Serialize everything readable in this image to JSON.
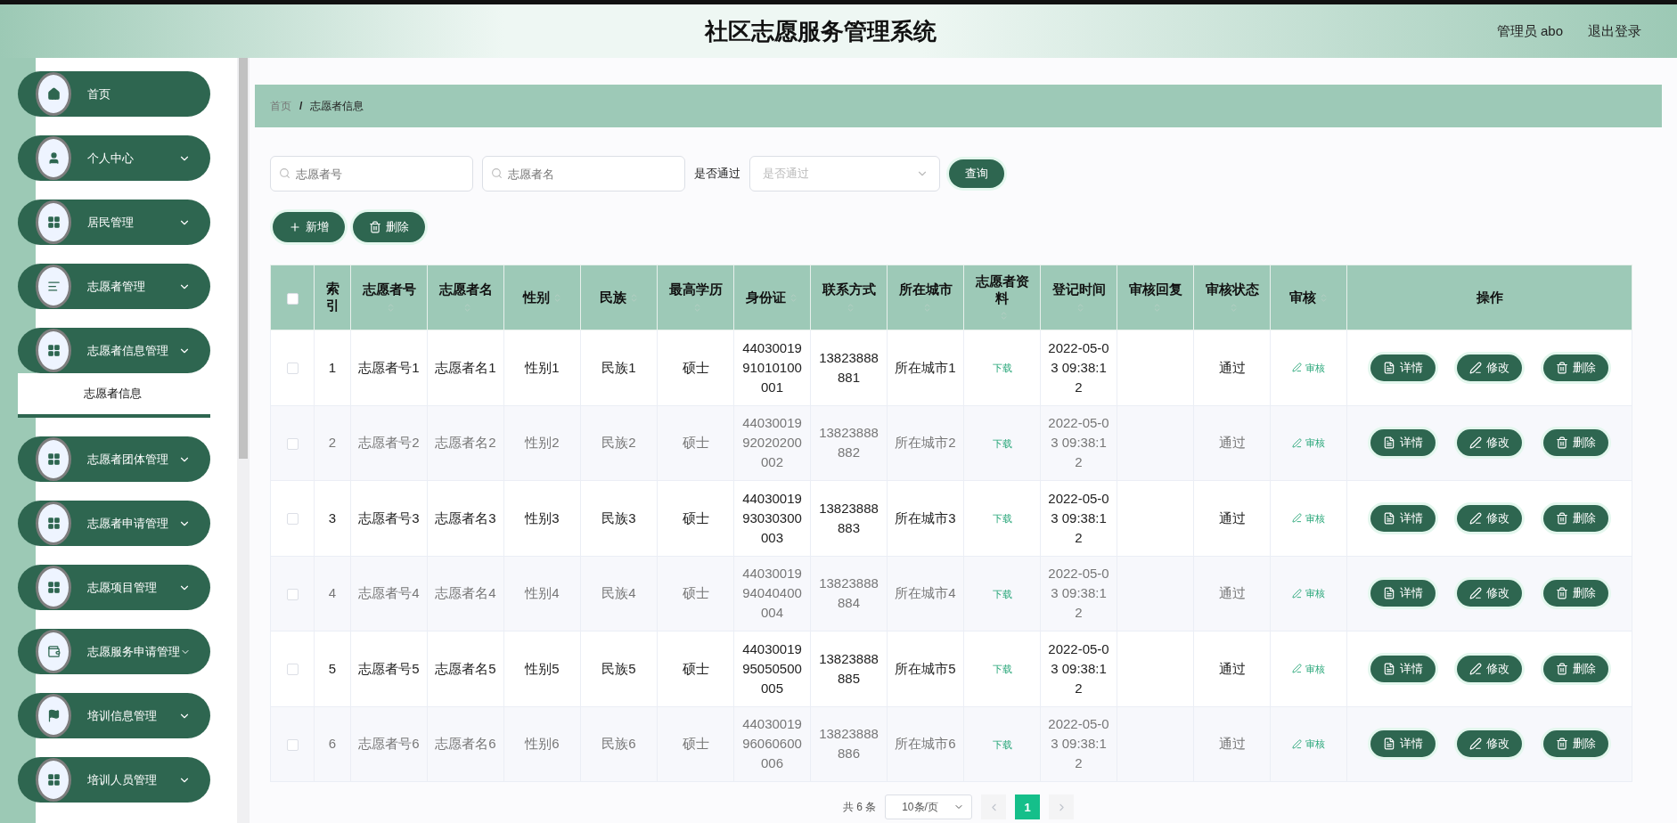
{
  "header": {
    "title": "社区志愿服务管理系统",
    "user": "管理员 abo",
    "logout": "退出登录"
  },
  "sidebar": {
    "items": [
      {
        "label": "首页",
        "kind": "home"
      },
      {
        "label": "个人中心",
        "kind": "user"
      },
      {
        "label": "居民管理",
        "kind": "grid"
      },
      {
        "label": "志愿者管理",
        "kind": "list"
      },
      {
        "label": "志愿者信息管理",
        "kind": "grid",
        "expanded": true,
        "children": [
          {
            "label": "志愿者信息",
            "selected": true
          }
        ]
      },
      {
        "label": "志愿者团体管理",
        "kind": "grid"
      },
      {
        "label": "志愿者申请管理",
        "kind": "grid"
      },
      {
        "label": "志愿项目管理",
        "kind": "grid"
      },
      {
        "label": "志愿服务申请管理",
        "kind": "wallet"
      },
      {
        "label": "培训信息管理",
        "kind": "flag"
      },
      {
        "label": "培训人员管理",
        "kind": "grid"
      }
    ]
  },
  "breadcrumb": {
    "items": [
      "首页",
      "志愿者信息"
    ],
    "separator": "/"
  },
  "filters": {
    "fields": [
      {
        "placeholder": "志愿者号"
      },
      {
        "placeholder": "志愿者名"
      }
    ],
    "select_label": "是否通过",
    "select": {
      "placeholder": "是否通过"
    },
    "search_button": "查询"
  },
  "toolbar": [
    {
      "label": "新增",
      "kind": "plus"
    },
    {
      "label": "删除",
      "kind": "trash"
    }
  ],
  "table": {
    "select_all_checked": false,
    "columns": [
      {
        "label": "索引",
        "kind": "index",
        "sortable": false
      },
      {
        "label": "志愿者号",
        "kind": "text",
        "sortable": true
      },
      {
        "label": "志愿者名",
        "kind": "text",
        "sortable": true
      },
      {
        "label": "性别",
        "kind": "text",
        "sortable": true
      },
      {
        "label": "民族",
        "kind": "text",
        "sortable": true
      },
      {
        "label": "最高学历",
        "kind": "text",
        "sortable": true
      },
      {
        "label": "身份证",
        "kind": "text",
        "sortable": true
      },
      {
        "label": "联系方式",
        "kind": "text",
        "sortable": true
      },
      {
        "label": "所在城市",
        "kind": "text",
        "sortable": true
      },
      {
        "label": "志愿者资料",
        "kind": "link",
        "sortable": true
      },
      {
        "label": "登记时间",
        "kind": "text",
        "sortable": true
      },
      {
        "label": "审核回复",
        "kind": "text",
        "sortable": true
      },
      {
        "label": "审核状态",
        "kind": "text",
        "sortable": true
      },
      {
        "label": "审核",
        "kind": "review",
        "sortable": true
      },
      {
        "label": "操作",
        "kind": "actions",
        "sortable": false
      }
    ],
    "rows": [
      {
        "checked": false,
        "cells": [
          "1",
          "志愿者号1",
          "志愿者名1",
          "性别1",
          "民族1",
          "硕士",
          "4403001991010100001",
          "13823888881",
          "所在城市1",
          "下载",
          "2022-05-03 09:38:12",
          null,
          "通过",
          "审核",
          [
            {
              "label": "详情",
              "kind": "doc"
            },
            {
              "label": "修改",
              "kind": "pen"
            },
            {
              "label": "删除",
              "kind": "trash"
            }
          ]
        ]
      },
      {
        "checked": false,
        "cells": [
          "2",
          "志愿者号2",
          "志愿者名2",
          "性别2",
          "民族2",
          "硕士",
          "4403001992020200002",
          "13823888882",
          "所在城市2",
          "下载",
          "2022-05-03 09:38:12",
          null,
          "通过",
          "审核",
          [
            {
              "label": "详情",
              "kind": "doc"
            },
            {
              "label": "修改",
              "kind": "pen"
            },
            {
              "label": "删除",
              "kind": "trash"
            }
          ]
        ]
      },
      {
        "checked": false,
        "cells": [
          "3",
          "志愿者号3",
          "志愿者名3",
          "性别3",
          "民族3",
          "硕士",
          "4403001993030300003",
          "13823888883",
          "所在城市3",
          "下载",
          "2022-05-03 09:38:12",
          null,
          "通过",
          "审核",
          [
            {
              "label": "详情",
              "kind": "doc"
            },
            {
              "label": "修改",
              "kind": "pen"
            },
            {
              "label": "删除",
              "kind": "trash"
            }
          ]
        ]
      },
      {
        "checked": false,
        "cells": [
          "4",
          "志愿者号4",
          "志愿者名4",
          "性别4",
          "民族4",
          "硕士",
          "4403001994040400004",
          "13823888884",
          "所在城市4",
          "下载",
          "2022-05-03 09:38:12",
          null,
          "通过",
          "审核",
          [
            {
              "label": "详情",
              "kind": "doc"
            },
            {
              "label": "修改",
              "kind": "pen"
            },
            {
              "label": "删除",
              "kind": "trash"
            }
          ]
        ]
      },
      {
        "checked": false,
        "cells": [
          "5",
          "志愿者号5",
          "志愿者名5",
          "性别5",
          "民族5",
          "硕士",
          "4403001995050500005",
          "13823888885",
          "所在城市5",
          "下载",
          "2022-05-03 09:38:12",
          null,
          "通过",
          "审核",
          [
            {
              "label": "详情",
              "kind": "doc"
            },
            {
              "label": "修改",
              "kind": "pen"
            },
            {
              "label": "删除",
              "kind": "trash"
            }
          ]
        ]
      },
      {
        "checked": false,
        "cells": [
          "6",
          "志愿者号6",
          "志愿者名6",
          "性别6",
          "民族6",
          "硕士",
          "4403001996060600006",
          "13823888886",
          "所在城市6",
          "下载",
          "2022-05-03 09:38:12",
          null,
          "通过",
          "审核",
          [
            {
              "label": "详情",
              "kind": "doc"
            },
            {
              "label": "修改",
              "kind": "pen"
            },
            {
              "label": "删除",
              "kind": "trash"
            }
          ]
        ]
      }
    ]
  },
  "pagination": {
    "total": "共 6 条",
    "page_size": "10条/页",
    "prev_disabled": true,
    "next_disabled": true,
    "pages": [
      {
        "label": "1",
        "selected": true
      }
    ]
  }
}
